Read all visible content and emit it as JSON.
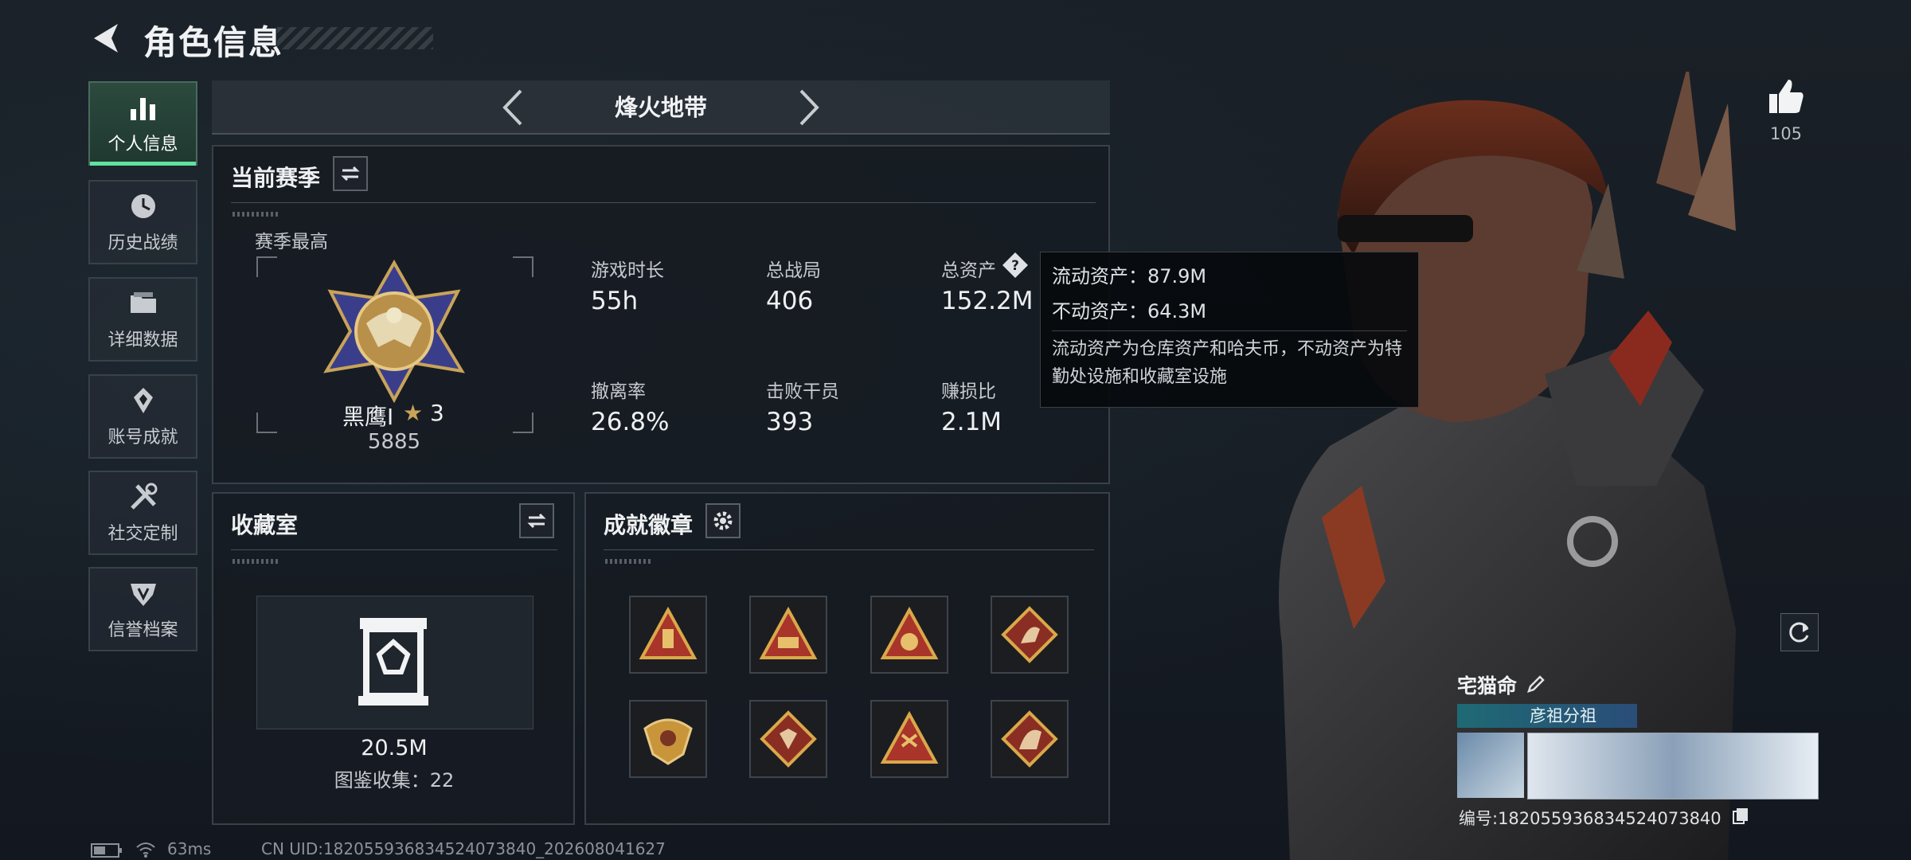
{
  "header": {
    "title": "角色信息"
  },
  "sidebar": {
    "items": [
      {
        "label": "个人信息",
        "icon": "bar-chart-icon",
        "active": true
      },
      {
        "label": "历史战绩",
        "icon": "history-icon"
      },
      {
        "label": "详细数据",
        "icon": "folder-icon"
      },
      {
        "label": "账号成就",
        "icon": "achievement-icon"
      },
      {
        "label": "社交定制",
        "icon": "tools-icon"
      },
      {
        "label": "信誉档案",
        "icon": "shield-icon"
      }
    ]
  },
  "mode_selector": {
    "label": "烽火地带"
  },
  "season": {
    "title": "当前赛季",
    "best_label": "赛季最高",
    "rank_name": "黑鹰Ⅰ",
    "rank_stars": "3",
    "rank_score": "5885",
    "stats": [
      {
        "label": "游戏时长",
        "value": "55h"
      },
      {
        "label": "总战局",
        "value": "406"
      },
      {
        "label": "总资产",
        "value": "152.2M"
      },
      {
        "label": "撤离率",
        "value": "26.8%"
      },
      {
        "label": "击败干员",
        "value": "393"
      },
      {
        "label": "赚损比",
        "value": "2.1M"
      }
    ]
  },
  "tooltip": {
    "liquid": "流动资产：87.9M",
    "fixed": "不动资产：64.3M",
    "note": "流动资产为仓库资产和哈夫币，不动资产为特勤处设施和收藏室设施"
  },
  "collection": {
    "title": "收藏室",
    "value": "20.5M",
    "count": "图鉴收集：22"
  },
  "badges": {
    "title": "成就徽章",
    "items": [
      "badge-1",
      "badge-2",
      "badge-3",
      "badge-4",
      "badge-5",
      "badge-6",
      "badge-7",
      "badge-8"
    ]
  },
  "likes": {
    "count": "105"
  },
  "player": {
    "name": "宅猫命",
    "title_banner": "彦祖分祖",
    "id_text": "编号:1820559368345240738​40"
  },
  "footer": {
    "ping": "63ms",
    "uid": "CN UID:182055936834524073840_202608041627"
  },
  "colors": {
    "accent": "#5fe3a0",
    "panel_border": "#3a4048",
    "gold": "#c9a35a"
  }
}
